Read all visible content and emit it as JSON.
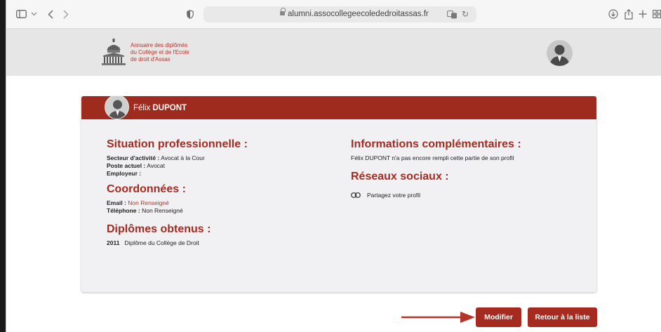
{
  "browser": {
    "url": "alumni.assocollegeecolededroitassas.fr"
  },
  "header": {
    "logo_lines": [
      "Annuaire des diplômés",
      "du Collège et de l'Ecole",
      "de droit d'Assas"
    ]
  },
  "profile": {
    "first_name": "Félix",
    "last_name": "DUPONT"
  },
  "professional": {
    "title": "Situation professionnelle :",
    "sector_label": "Secteur d'activité :",
    "sector_value": "Avocat à la Cour",
    "position_label": "Poste actuel :",
    "position_value": "Avocat",
    "employer_label": "Employeur :",
    "employer_value": ""
  },
  "contact": {
    "title": "Coordonnées :",
    "email_label": "Email :",
    "email_value": "Non Renseigné",
    "phone_label": "Téléphone :",
    "phone_value": "Non Renseigné"
  },
  "diplomas": {
    "title": "Diplômes obtenus :",
    "items": [
      {
        "year": "2011",
        "name": "Diplôme du Collège de Droit"
      }
    ]
  },
  "additional": {
    "title": "Informations complémentaires :",
    "text": "Félix DUPONT n'a pas encore rempli cette partie de son profil"
  },
  "social": {
    "title": "Réseaux sociaux :",
    "share_label": "Partagez votre profil"
  },
  "actions": {
    "modify_label": "Modifier",
    "back_label": "Retour à la liste"
  },
  "colors": {
    "accent": "#9f2a1e",
    "header_bg": "#e6e6e6",
    "card_bg": "#f1f1f3"
  }
}
